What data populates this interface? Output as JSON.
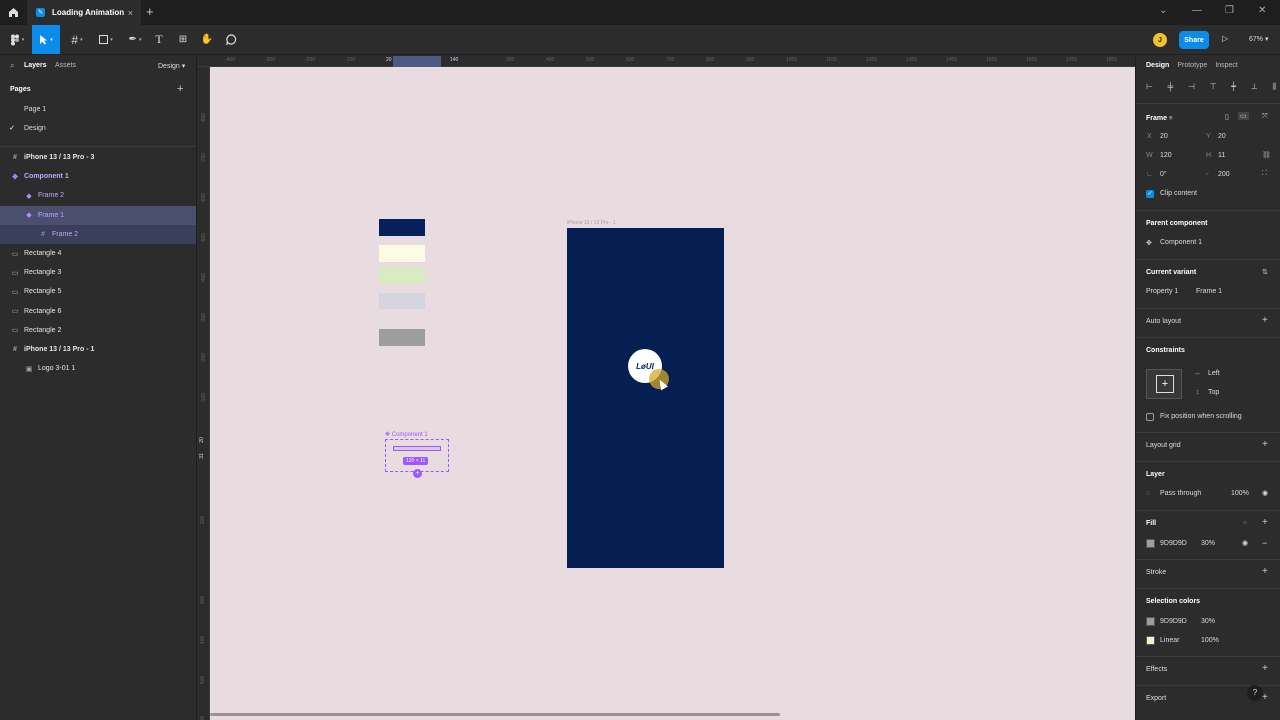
{
  "window": {
    "tab_title": "Loading Animation",
    "tab_close": "×",
    "new_tab": "+",
    "controls": [
      "⌄",
      "—",
      "❐",
      "✕"
    ]
  },
  "toolbar": {
    "avatar_initial": "J",
    "share_label": "Share",
    "zoom_label": "67%"
  },
  "left_panel": {
    "tab_layers": "Layers",
    "tab_assets": "Assets",
    "design_dropdown": "Design",
    "pages_title": "Pages",
    "pages": [
      {
        "label": "Page 1",
        "active": false
      },
      {
        "label": "Design",
        "active": true
      }
    ],
    "layers": [
      {
        "label": "iPhone 13 / 13 Pro - 3",
        "icon": "frame-icon",
        "glyph": "#",
        "indent": 0,
        "state": "normal",
        "bold": true
      },
      {
        "label": "Component 1",
        "icon": "component-icon",
        "glyph": "✥",
        "indent": 0,
        "state": "purple",
        "bold": true
      },
      {
        "label": "Frame 2",
        "icon": "variant-icon",
        "glyph": "◆",
        "indent": 1,
        "state": "purple",
        "bold": false
      },
      {
        "label": "Frame 1",
        "icon": "variant-icon",
        "glyph": "◆",
        "indent": 1,
        "state": "selected",
        "bold": false
      },
      {
        "label": "Frame 2",
        "icon": "frame-icon",
        "glyph": "#",
        "indent": 2,
        "state": "selchild",
        "bold": false
      },
      {
        "label": "Rectangle 4",
        "icon": "rectangle-icon",
        "glyph": "▭",
        "indent": 0,
        "state": "normal",
        "bold": false
      },
      {
        "label": "Rectangle 3",
        "icon": "rectangle-icon",
        "glyph": "▭",
        "indent": 0,
        "state": "normal",
        "bold": false
      },
      {
        "label": "Rectangle 5",
        "icon": "rectangle-icon",
        "glyph": "▭",
        "indent": 0,
        "state": "normal",
        "bold": false
      },
      {
        "label": "Rectangle 6",
        "icon": "rectangle-icon",
        "glyph": "▭",
        "indent": 0,
        "state": "normal",
        "bold": false
      },
      {
        "label": "Rectangle 2",
        "icon": "rectangle-icon",
        "glyph": "▭",
        "indent": 0,
        "state": "normal",
        "bold": false
      },
      {
        "label": "iPhone 13 / 13 Pro - 1",
        "icon": "frame-icon",
        "glyph": "#",
        "indent": 0,
        "state": "normal",
        "bold": true
      },
      {
        "label": "Logo 3-01 1",
        "icon": "image-icon",
        "glyph": "▣",
        "indent": 1,
        "state": "normal",
        "bold": false
      }
    ]
  },
  "rulers": {
    "top": [
      "-400",
      "-300",
      "-200",
      "-100",
      "20",
      "140",
      "300",
      "400",
      "500",
      "600",
      "700",
      "800",
      "900",
      "1000",
      "1100",
      "1200",
      "1300",
      "1400",
      "1500",
      "1600",
      "1700",
      "1800"
    ],
    "left": [
      "-800",
      "-700",
      "-600",
      "-500",
      "-400",
      "-300",
      "-200",
      "-100",
      "20",
      "31",
      "200",
      "300",
      "400",
      "500",
      "600"
    ]
  },
  "canvas": {
    "background": "#e9dce0",
    "swatches": [
      {
        "name": "swatch-navy",
        "color": "#05205a"
      },
      {
        "name": "swatch-cream",
        "color": "#fdfbe6"
      },
      {
        "name": "swatch-lightgreen",
        "color": "#d9ecc1"
      },
      {
        "name": "swatch-lavender",
        "color": "#d4d5df"
      },
      {
        "name": "swatch-gray",
        "color": "#9d9d9d"
      }
    ],
    "phone_frame_label": "iPhone 13 / 13 Pro - 1",
    "phone_color": "#061f52",
    "logo_text": "LøUI",
    "component_label": "✥ Component 1",
    "size_badge": "120 × 11"
  },
  "right_panel": {
    "tabs": {
      "design": "Design",
      "prototype": "Prototype",
      "inspect": "Inspect"
    },
    "frame_title": "Frame",
    "x_label": "X",
    "x_value": "20",
    "y_label": "Y",
    "y_value": "20",
    "w_label": "W",
    "w_value": "120",
    "h_label": "H",
    "h_value": "11",
    "rotation_value": "0°",
    "radius_value": "200",
    "clip_content": "Clip content",
    "parent_component_title": "Parent component",
    "parent_component_value": "Component 1",
    "current_variant_title": "Current variant",
    "property_label": "Property 1",
    "property_value": "Frame 1",
    "auto_layout": "Auto layout",
    "constraints_title": "Constraints",
    "constraint_h": "Left",
    "constraint_v": "Top",
    "fix_position": "Fix position when scrolling",
    "layout_grid": "Layout grid",
    "layer_title": "Layer",
    "blend_mode": "Pass through",
    "layer_opacity": "100%",
    "fill_title": "Fill",
    "fill_hex": "9D9D9D",
    "fill_opacity": "30%",
    "fill_color": "#9d9d9d",
    "stroke_title": "Stroke",
    "selection_colors_title": "Selection colors",
    "sel_colors": [
      {
        "label": "9D9D9D",
        "opacity": "30%",
        "color": "#9d9d9d"
      },
      {
        "label": "Linear",
        "opacity": "100%",
        "color": "#f2f3cf"
      }
    ],
    "effects_title": "Effects",
    "export_title": "Export",
    "help": "?"
  }
}
